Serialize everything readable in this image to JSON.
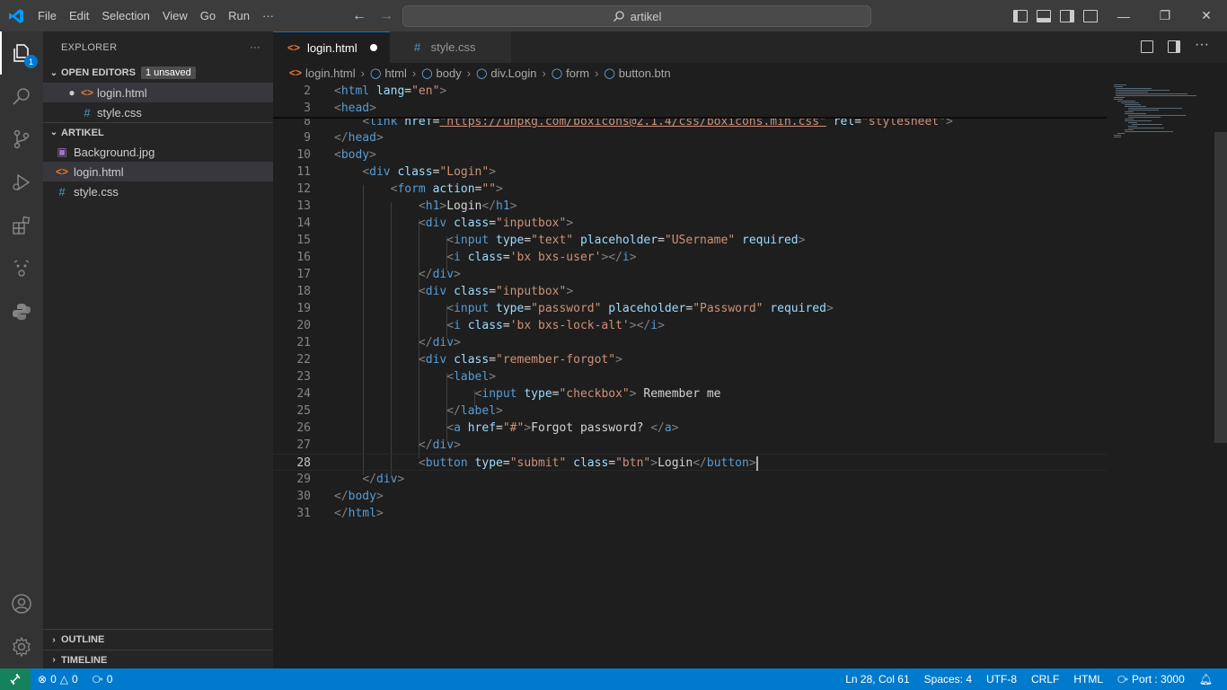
{
  "titlebar": {
    "menu": [
      "File",
      "Edit",
      "Selection",
      "View",
      "Go",
      "Run",
      "···"
    ],
    "search_text": "artikel",
    "back_arrow": "←",
    "forward_arrow": "→"
  },
  "activitybar": {
    "explorer_badge": "1",
    "items": [
      "files-icon",
      "search-icon",
      "source-control-icon",
      "run-debug-icon",
      "extensions-icon",
      "live-share-icon",
      "python-icon",
      "account-icon",
      "settings-icon"
    ]
  },
  "sidebar": {
    "title": "EXPLORER",
    "more": "···",
    "open_editors": {
      "label": "OPEN EDITORS",
      "badge": "1 unsaved",
      "files": [
        {
          "name": "login.html",
          "icon": "<>"
        },
        {
          "name": "style.css",
          "icon": "#"
        }
      ]
    },
    "folder": {
      "label": "ARTIKEL",
      "files": [
        {
          "name": "Background.jpg",
          "icon": "▣"
        },
        {
          "name": "login.html",
          "icon": "<>"
        },
        {
          "name": "style.css",
          "icon": "#"
        }
      ]
    },
    "outline_label": "OUTLINE",
    "timeline_label": "TIMELINE"
  },
  "tabs": [
    {
      "label": "login.html",
      "icon": "<>"
    },
    {
      "label": "style.css",
      "icon": "#"
    }
  ],
  "breadcrumb": [
    "login.html",
    "html",
    "body",
    "div.Login",
    "form",
    "button.btn"
  ],
  "editor": {
    "lines": [
      {
        "n": "2"
      },
      {
        "n": "3"
      },
      {
        "n": "8"
      },
      {
        "n": "9"
      },
      {
        "n": "10"
      },
      {
        "n": "11"
      },
      {
        "n": "12"
      },
      {
        "n": "13"
      },
      {
        "n": "14"
      },
      {
        "n": "15"
      },
      {
        "n": "16"
      },
      {
        "n": "17"
      },
      {
        "n": "18"
      },
      {
        "n": "19"
      },
      {
        "n": "20"
      },
      {
        "n": "21"
      },
      {
        "n": "22"
      },
      {
        "n": "23"
      },
      {
        "n": "24"
      },
      {
        "n": "25"
      },
      {
        "n": "26"
      },
      {
        "n": "27"
      },
      {
        "n": "28"
      },
      {
        "n": "29"
      },
      {
        "n": "30"
      },
      {
        "n": "31"
      }
    ],
    "code": {
      "l2_lang": "\"en\"",
      "l8_href": "\"https://unpkg.com/boxicons@2.1.4/css/boxicons.min.css\"",
      "l8_rel": "\"stylesheet\"",
      "l11_class": "\"Login\"",
      "l12_action": "\"\"",
      "l13_text": "Login",
      "l14_class": "\"inputbox\"",
      "l15_type": "\"text\"",
      "l15_ph": "\"USername\"",
      "l16_class": "'bx bxs-user'",
      "l18_class": "\"inputbox\"",
      "l19_type": "\"password\"",
      "l19_ph": "\"Password\"",
      "l20_class": "'bx bxs-lock-alt'",
      "l22_class": "\"remember-forgot\"",
      "l24_type": "\"checkbox\"",
      "l24_text": " Remember me",
      "l26_href": "\"#\"",
      "l26_text": "Forgot password? ",
      "l28_type": "\"submit\"",
      "l28_class": "\"btn\"",
      "l28_text": "Login"
    }
  },
  "statusbar": {
    "errors": "0",
    "warnings": "0",
    "ports": "0",
    "position": "Ln 28, Col 61",
    "spaces": "Spaces: 4",
    "encoding": "UTF-8",
    "eol": "CRLF",
    "language": "HTML",
    "port": "Port : 3000"
  },
  "colors": {
    "accent": "#007acc",
    "tag": "#569cd6",
    "attr": "#9cdcfe",
    "string": "#ce9178"
  }
}
